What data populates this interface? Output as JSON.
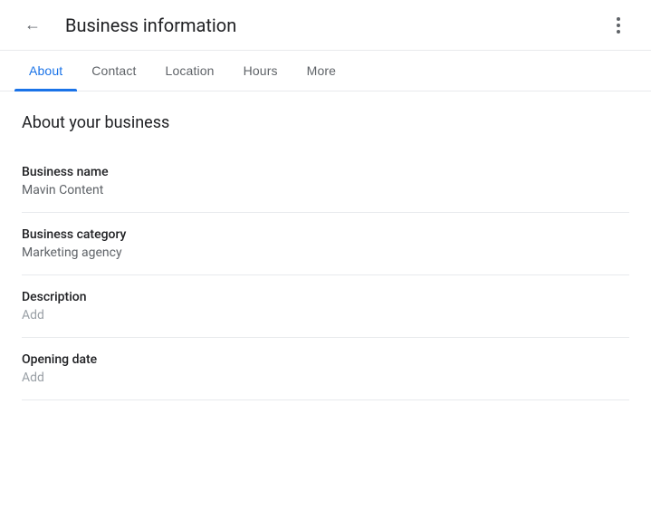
{
  "header": {
    "title": "Business information",
    "back_label": "back",
    "more_options_label": "more options"
  },
  "tabs": {
    "items": [
      {
        "label": "About",
        "active": true
      },
      {
        "label": "Contact",
        "active": false
      },
      {
        "label": "Location",
        "active": false
      },
      {
        "label": "Hours",
        "active": false
      },
      {
        "label": "More",
        "active": false
      }
    ]
  },
  "main": {
    "section_title": "About your business",
    "fields": [
      {
        "label": "Business name",
        "value": "Mavin Content",
        "is_placeholder": false
      },
      {
        "label": "Business category",
        "value": "Marketing agency",
        "is_placeholder": false
      },
      {
        "label": "Description",
        "value": "Add",
        "is_placeholder": true
      },
      {
        "label": "Opening date",
        "value": "Add",
        "is_placeholder": true
      }
    ]
  },
  "colors": {
    "active_tab": "#1a73e8",
    "divider": "#e8eaed",
    "text_primary": "#202124",
    "text_secondary": "#5f6368",
    "text_placeholder": "#9aa0a6"
  }
}
